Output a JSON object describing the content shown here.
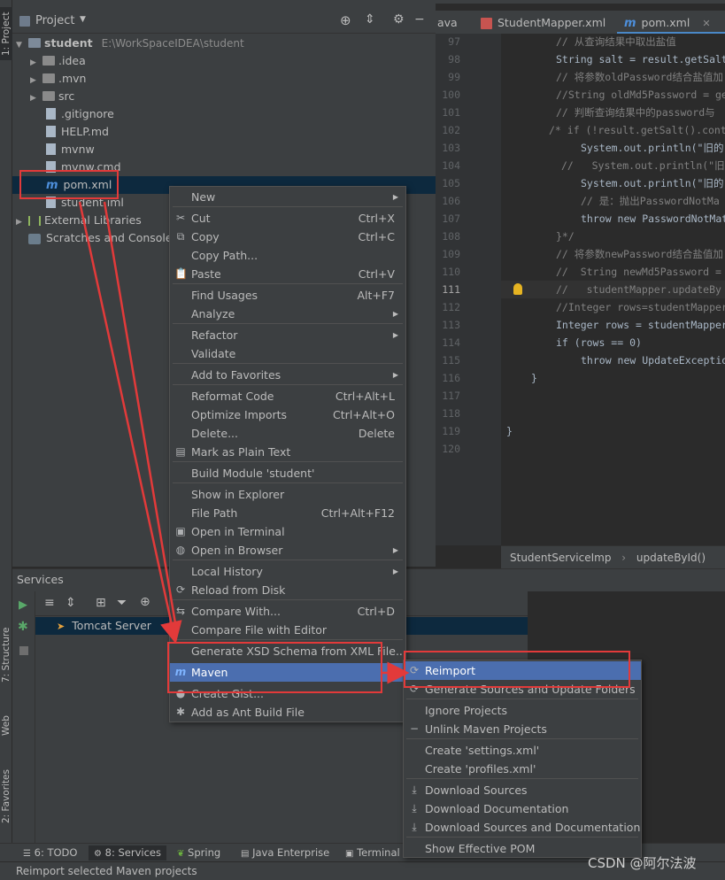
{
  "top_tabs": {
    "project_label": "Project",
    "tab_java_fragment": "ava",
    "tab_mapper": "StudentMapper.xml",
    "tab_pom": "pom.xml"
  },
  "side_stripes": {
    "project": "1: Project",
    "structure": "7: Structure",
    "web": "Web",
    "favorites": "2: Favorites"
  },
  "project_tree": {
    "root_name": "student",
    "root_path": "E:\\WorkSpaceIDEA\\student",
    "items": [
      {
        "label": ".idea",
        "kind": "folder"
      },
      {
        "label": ".mvn",
        "kind": "folder"
      },
      {
        "label": "src",
        "kind": "folder"
      },
      {
        "label": ".gitignore",
        "kind": "file"
      },
      {
        "label": "HELP.md",
        "kind": "file"
      },
      {
        "label": "mvnw",
        "kind": "file"
      },
      {
        "label": "mvnw.cmd",
        "kind": "file"
      },
      {
        "label": "pom.xml",
        "kind": "maven"
      },
      {
        "label": "student.iml",
        "kind": "file"
      }
    ],
    "external_libraries": "External Libraries",
    "scratches": "Scratches and Consoles"
  },
  "editor": {
    "lines": [
      {
        "n": "97",
        "t": "// 从查询结果中取出盐值"
      },
      {
        "n": "98",
        "t": "String salt = result.getSalt"
      },
      {
        "n": "99",
        "t": "// 将参数oldPassword结合盐值加"
      },
      {
        "n": "100",
        "t": "//String oldMd5Password = get"
      },
      {
        "n": "101",
        "t": "// 判断查询结果中的password与"
      },
      {
        "n": "102",
        "t": "/* if (!result.getSalt().cont"
      },
      {
        "n": "103",
        "t": "System.out.println(\"旧的"
      },
      {
        "n": "104",
        "t": "//   System.out.println(\"旧"
      },
      {
        "n": "105",
        "t": "System.out.println(\"旧的"
      },
      {
        "n": "106",
        "t": "// 是：抛出PasswordNotMa"
      },
      {
        "n": "107",
        "t": "throw new PasswordNotMat"
      },
      {
        "n": "108",
        "t": "}*/"
      },
      {
        "n": "109",
        "t": "// 将参数newPassword结合盐值加"
      },
      {
        "n": "110",
        "t": "//  String newMd5Password = "
      },
      {
        "n": "111",
        "t": "//   studentMapper.updateBy"
      },
      {
        "n": "112",
        "t": "//Integer rows=studentMapper."
      },
      {
        "n": "113",
        "t": "Integer rows = studentMapper"
      },
      {
        "n": "114",
        "t": "if (rows == 0)"
      },
      {
        "n": "115",
        "t": "throw new UpdateExceptio"
      },
      {
        "n": "116",
        "t": "}"
      },
      {
        "n": "117",
        "t": ""
      },
      {
        "n": "118",
        "t": ""
      },
      {
        "n": "119",
        "t": "}"
      },
      {
        "n": "120",
        "t": ""
      }
    ],
    "breadcrumb_class": "StudentServiceImp",
    "breadcrumb_sep": "›",
    "breadcrumb_method": "updateById()"
  },
  "services": {
    "title": "Services",
    "tomcat": "Tomcat Server"
  },
  "context_menu": {
    "new": "New",
    "cut": "Cut",
    "cut_sc": "Ctrl+X",
    "copy": "Copy",
    "copy_sc": "Ctrl+C",
    "copy_path": "Copy Path...",
    "paste": "Paste",
    "paste_sc": "Ctrl+V",
    "find_usages": "Find Usages",
    "find_usages_sc": "Alt+F7",
    "analyze": "Analyze",
    "refactor": "Refactor",
    "validate": "Validate",
    "add_favorites": "Add to Favorites",
    "reformat": "Reformat Code",
    "reformat_sc": "Ctrl+Alt+L",
    "optimize": "Optimize Imports",
    "optimize_sc": "Ctrl+Alt+O",
    "delete": "Delete...",
    "delete_sc": "Delete",
    "mark_plain": "Mark as Plain Text",
    "build_module": "Build Module 'student'",
    "show_explorer": "Show in Explorer",
    "file_path": "File Path",
    "file_path_sc": "Ctrl+Alt+F12",
    "open_terminal": "Open in Terminal",
    "open_browser": "Open in Browser",
    "local_history": "Local History",
    "reload_disk": "Reload from Disk",
    "compare_with": "Compare With...",
    "compare_with_sc": "Ctrl+D",
    "compare_editor": "Compare File with Editor",
    "generate_xsd": "Generate XSD Schema from XML File...",
    "maven": "Maven",
    "create_gist": "Create Gist...",
    "add_ant": "Add as Ant Build File"
  },
  "maven_menu": {
    "reimport": "Reimport",
    "generate_sources": "Generate Sources and Update Folders",
    "ignore_projects": "Ignore Projects",
    "unlink_projects": "Unlink Maven Projects",
    "create_settings": "Create 'settings.xml'",
    "create_profiles": "Create 'profiles.xml'",
    "download_sources": "Download Sources",
    "download_docs": "Download Documentation",
    "download_both": "Download Sources and Documentation",
    "show_effective_pom": "Show Effective POM"
  },
  "bottom_tabs": {
    "todo": "6: TODO",
    "services": "8: Services",
    "spring": "Spring",
    "java_ee": "Java Enterprise",
    "terminal": "Terminal"
  },
  "status": "Reimport selected Maven projects",
  "watermark": "CSDN @阿尔法波",
  "colors": {
    "highlight": "#4b6eaf",
    "annotation_red": "#e23a3a",
    "maven_blue": "#4d8fdb",
    "panel": "#3c3f41",
    "editor_bg": "#2b2b2b"
  }
}
